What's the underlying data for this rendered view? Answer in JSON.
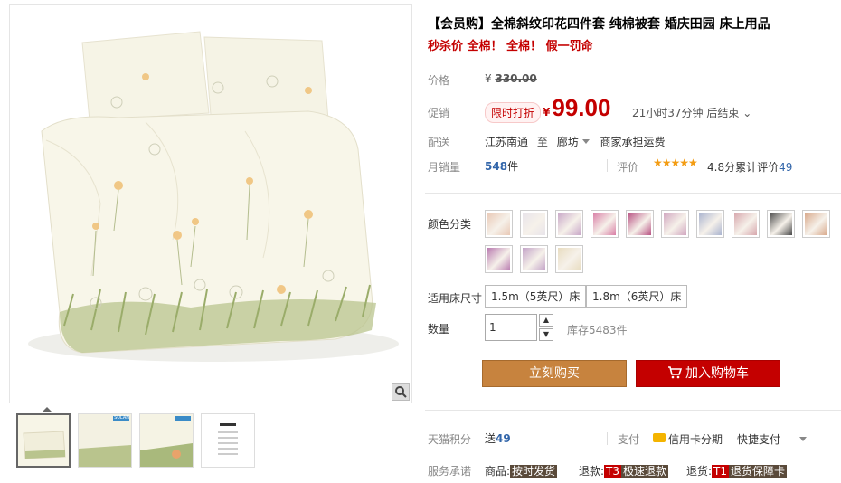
{
  "product": {
    "title": "【会员购】全棉斜纹印花四件套 纯棉被套 婚庆田园 床上用品",
    "subtitle": "秒杀价 全棉！ 全棉！ 假一罚命"
  },
  "price_section": {
    "price_label": "价格",
    "original_currency": "¥",
    "original_price": "330.00",
    "promo_label": "促销",
    "promo_badge": "限时打折",
    "currency": "¥",
    "price": "99.00",
    "countdown": "21小时37分钟 后结束",
    "countdown_arrow": "⌄"
  },
  "shipping": {
    "label": "配送",
    "from": "江苏南通",
    "to_word": "至",
    "to": "廊坊",
    "fee": "商家承担运费"
  },
  "sales": {
    "label": "月销量",
    "count": "548",
    "unit": "件",
    "rating_label": "评价",
    "stars": "★★★★★",
    "score_text": "4.8分累计评价",
    "review_count": "49"
  },
  "options": {
    "color_label": "颜色分类",
    "colors": [
      "#e9c9b6",
      "#e8e4ea",
      "#c9a8c8",
      "#d97fa6",
      "#b95484",
      "#d1a7c0",
      "#aab4cf",
      "#d7a7ad",
      "#4a4a4a",
      "#d8a88a",
      "#b97bb0",
      "#c3a3c7",
      "#e8dcc0"
    ],
    "size_label": "适用床尺寸",
    "sizes": [
      "1.5m（5英尺）床",
      "1.8m（6英尺）床"
    ],
    "qty_label": "数量",
    "qty_value": "1",
    "stock": "库存5483件"
  },
  "actions": {
    "buy_now": "立刻购买",
    "add_to_cart": "加入购物车"
  },
  "extras": {
    "points_label": "天猫积分",
    "points_prefix": "送",
    "points": "49",
    "pay_label": "支付",
    "credit": "信用卡分期",
    "quick_pay": "快捷支付",
    "service_label": "服务承诺",
    "svc1_prefix": "商品:",
    "svc1_tag": "按时发货",
    "svc2_prefix": "退款:",
    "svc2_code": "T3",
    "svc2_tag": "极速退款",
    "svc3_prefix": "退货:",
    "svc3_code": "T1",
    "svc3_tag": "退货保障卡"
  },
  "gallery": {
    "thumb_brand": "SULAN"
  }
}
